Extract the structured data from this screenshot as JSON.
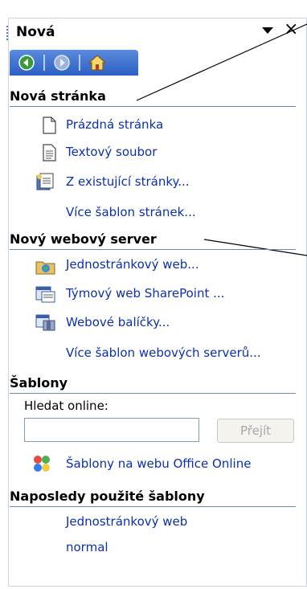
{
  "pane": {
    "title": "Nová"
  },
  "sections": {
    "new_page": {
      "heading": "Nová stránka",
      "items": [
        {
          "label": "Prázdná stránka",
          "icon": "blank-page-icon"
        },
        {
          "label": "Textový soubor",
          "icon": "text-file-icon"
        },
        {
          "label": "Z existující stránky...",
          "icon": "existing-page-icon"
        },
        {
          "label": "Více šablon stránek..."
        }
      ]
    },
    "new_web": {
      "heading": "Nový webový server",
      "items": [
        {
          "label": "Jednostránkový web...",
          "icon": "one-page-web-icon"
        },
        {
          "label": "Týmový web SharePoint ...",
          "icon": "sharepoint-web-icon"
        },
        {
          "label": "Webové balíčky...",
          "icon": "web-package-icon"
        },
        {
          "label": "Více šablon webových serverů..."
        }
      ]
    },
    "templates": {
      "heading": "Šablony",
      "search_label": "Hledat online:",
      "search_value": "",
      "go_label": "Přejít",
      "office_online_label": "Šablony na webu Office Online"
    },
    "recent": {
      "heading": "Naposledy použité šablony",
      "items": [
        "Jednostránkový web",
        "normal"
      ]
    }
  }
}
